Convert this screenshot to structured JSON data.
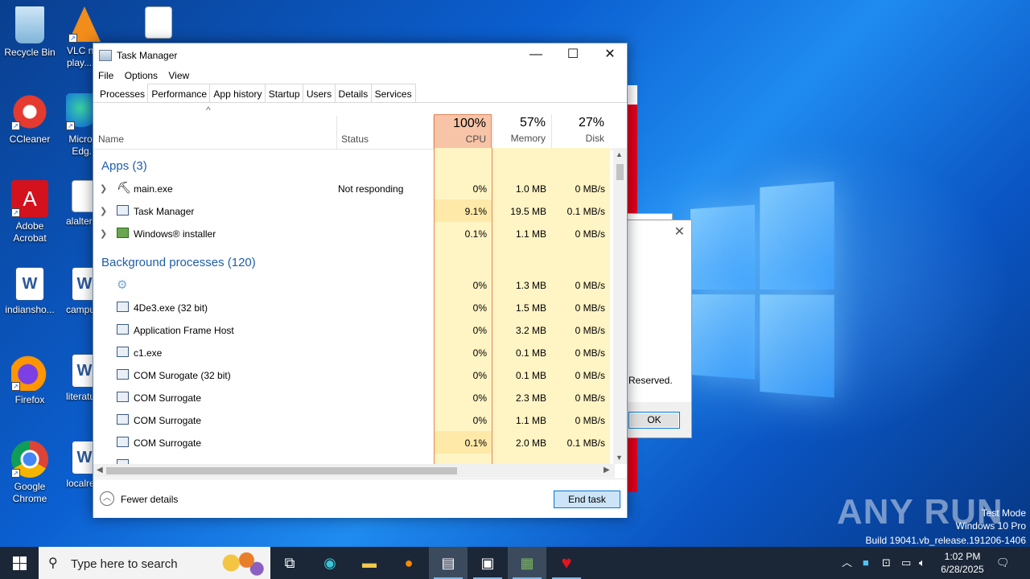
{
  "desktop": {
    "icons": [
      {
        "label": "Recycle Bin"
      },
      {
        "label": "VLC n... play..."
      },
      {
        "label": "CCleaner"
      },
      {
        "label": "Micro... Edg..."
      },
      {
        "label": "Adobe Acrobat"
      },
      {
        "label": "alalterr..."
      },
      {
        "label": "indiansho..."
      },
      {
        "label": "campu..."
      },
      {
        "label": "Firefox"
      },
      {
        "label": "literatu..."
      },
      {
        "label": "Google Chrome"
      },
      {
        "label": "localre..."
      }
    ]
  },
  "dialog": {
    "text": "Reserved.",
    "ok_label": "OK"
  },
  "task_manager": {
    "title": "Task Manager",
    "menu": [
      "File",
      "Options",
      "View"
    ],
    "tabs": [
      "Processes",
      "Performance",
      "App history",
      "Startup",
      "Users",
      "Details",
      "Services"
    ],
    "active_tab": "Processes",
    "columns": {
      "name": "Name",
      "status": "Status",
      "cpu_pct": "100%",
      "cpu_label": "CPU",
      "mem_pct": "57%",
      "mem_label": "Memory",
      "disk_pct": "27%",
      "disk_label": "Disk"
    },
    "groups": {
      "apps": "Apps (3)",
      "background": "Background processes (120)"
    },
    "apps": [
      {
        "name": "main.exe",
        "status": "Not responding",
        "cpu": "0%",
        "mem": "1.0 MB",
        "disk": "0 MB/s"
      },
      {
        "name": "Task Manager",
        "status": "",
        "cpu": "9.1%",
        "mem": "19.5 MB",
        "disk": "0.1 MB/s"
      },
      {
        "name": "Windows® installer",
        "status": "",
        "cpu": "0.1%",
        "mem": "1.1 MB",
        "disk": "0 MB/s"
      }
    ],
    "background": [
      {
        "name": "",
        "cpu": "0%",
        "mem": "1.3 MB",
        "disk": "0 MB/s"
      },
      {
        "name": "4De3.exe (32 bit)",
        "cpu": "0%",
        "mem": "1.5 MB",
        "disk": "0 MB/s"
      },
      {
        "name": "Application Frame Host",
        "cpu": "0%",
        "mem": "3.2 MB",
        "disk": "0 MB/s"
      },
      {
        "name": "c1.exe",
        "cpu": "0%",
        "mem": "0.1 MB",
        "disk": "0 MB/s"
      },
      {
        "name": "COM Surogate (32 bit)",
        "cpu": "0%",
        "mem": "0.1 MB",
        "disk": "0 MB/s"
      },
      {
        "name": "COM Surrogate",
        "cpu": "0%",
        "mem": "2.3 MB",
        "disk": "0 MB/s"
      },
      {
        "name": "COM Surrogate",
        "cpu": "0%",
        "mem": "1.1 MB",
        "disk": "0 MB/s"
      },
      {
        "name": "COM Surrogate",
        "cpu": "0.1%",
        "mem": "2.0 MB",
        "disk": "0.1 MB/s"
      }
    ],
    "footer": {
      "fewer_details": "Fewer details",
      "end_task": "End task"
    }
  },
  "watermark": {
    "brand": "ANY RUN",
    "line1": "Test Mode",
    "line2": "Windows 10 Pro",
    "line3": "Build 19041.vb_release.191206-1406"
  },
  "taskbar": {
    "search_placeholder": "Type here to search",
    "time": "1:02 PM",
    "date": "6/28/2025"
  }
}
